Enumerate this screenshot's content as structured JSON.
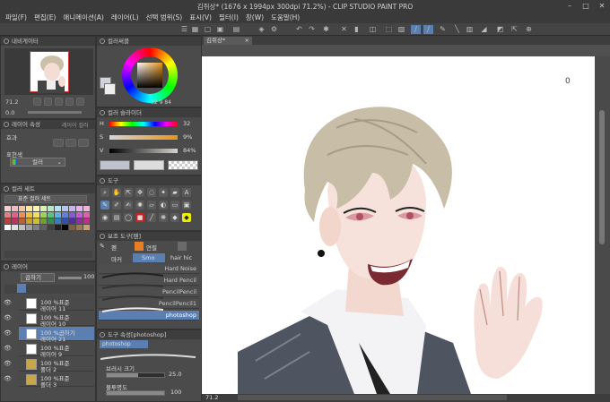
{
  "window": {
    "title": "김쥐상* (1676 x 1994px 300dpi 71.2%)  - CLIP STUDIO PAINT PRO"
  },
  "menu": [
    "파일(F)",
    "편집(E)",
    "애니메이션(A)",
    "레이어(L)",
    "선택 범위(S)",
    "표시(V)",
    "필터(I)",
    "창(W)",
    "도움말(H)"
  ],
  "canvas_tab": "김쥐상*",
  "navigator": {
    "title": "내비게이터",
    "zoom": "71.2",
    "rotate": "0.0"
  },
  "color_wheel": {
    "title": "컬러써클",
    "h": "32",
    "s": "9",
    "v": "84"
  },
  "color_slider": {
    "title": "컬러 슬라이더",
    "rows": [
      {
        "label": "H",
        "value": "32"
      },
      {
        "label": "S",
        "value": "9%"
      },
      {
        "label": "V",
        "value": "84%"
      }
    ]
  },
  "layer_property": {
    "title": "레이어 속성",
    "subtitle": "레이어 컬러",
    "effect_label": "효과",
    "expression_label": "표현색",
    "expression_value": "컬러"
  },
  "color_set": {
    "title": "컬러 세트",
    "set_name": "표준 컬러 세트"
  },
  "color_set_swatches": [
    "#f5d0d0",
    "#f2b8c6",
    "#f7c6a3",
    "#ffe6a3",
    "#fff2b3",
    "#d9f2b3",
    "#b3e6c6",
    "#b3e0f2",
    "#b3c6f2",
    "#c6b3f2",
    "#e6b3f2",
    "#f2b3d9",
    "#e08080",
    "#e06090",
    "#e89060",
    "#f0c040",
    "#f0e060",
    "#a0d060",
    "#60c080",
    "#60b0e0",
    "#6080e0",
    "#8060d0",
    "#c060d0",
    "#e060b0",
    "#c04040",
    "#c03060",
    "#c06030",
    "#d0a020",
    "#d0c030",
    "#70a030",
    "#309050",
    "#3080c0",
    "#3050b0",
    "#5030a0",
    "#9030a0",
    "#c03080",
    "#ffffff",
    "#e0e0e0",
    "#c0c0c0",
    "#a0a0a0",
    "#808080",
    "#606060",
    "#404040",
    "#202020",
    "#000000",
    "#806040",
    "#a07850",
    "#c8a070"
  ],
  "tool_panel": {
    "title": "도구"
  },
  "sub_tool": {
    "title": "보조 도구[펜]",
    "tabs": [
      "펜",
      "연필",
      "마커"
    ],
    "tab2": [
      "Smo",
      "hair hic"
    ],
    "brushes": [
      "Hard Noise",
      "Hard Pencil",
      "PencilPencil",
      "PencilPencil1",
      "photoshop"
    ]
  },
  "tool_property": {
    "title": "도구 속성[photoshop]",
    "brush_name": "photoshop",
    "size_label": "브러시 크기",
    "size_value": "25.0",
    "opacity_label": "불투명도",
    "opacity_value": "100"
  },
  "layers": {
    "title": "레이어",
    "blend": "곱하기",
    "opacity": "100",
    "items": [
      {
        "pct": "100 %표준",
        "name": "레이어 11"
      },
      {
        "pct": "100 %표준",
        "name": "레이어 10"
      },
      {
        "pct": "100 %곱하기",
        "name": "레이어 21"
      },
      {
        "pct": "100 %표준",
        "name": "레이어 9"
      },
      {
        "pct": "100 %표준",
        "name": "폴더 2"
      },
      {
        "pct": "100 %표준",
        "name": "폴더 3"
      }
    ]
  },
  "status": {
    "zoom": "71.2",
    "cursor_value": "0"
  },
  "colors": {
    "accent": "#5b7fb0",
    "bg": "#505050",
    "canvas": "#ffffff"
  }
}
